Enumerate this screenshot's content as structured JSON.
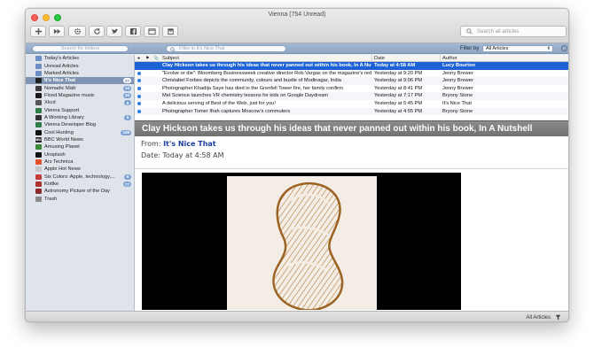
{
  "window": {
    "title": "Vienna (754 Unread)"
  },
  "toolbar": {
    "buttons": [
      {
        "name": "new-subscription",
        "icon": "plus-icon"
      },
      {
        "name": "skip-unread",
        "icon": "fast-forward-icon"
      },
      {
        "name": "action-menu",
        "icon": "gear-icon"
      },
      {
        "name": "refresh",
        "icon": "refresh-icon"
      },
      {
        "name": "share-twitter",
        "icon": "bird-icon"
      },
      {
        "name": "share-facebook",
        "icon": "facebook-icon"
      },
      {
        "name": "open-browser",
        "icon": "window-icon"
      },
      {
        "name": "archive",
        "icon": "archive-icon"
      }
    ],
    "search_placeholder": "Search all articles"
  },
  "filterbar": {
    "folder_search_placeholder": "Search for folders",
    "article_filter_placeholder": "Filter in It's Nice That",
    "filter_by_label": "Filter by",
    "filter_by_value": "All Articles"
  },
  "sidebar": {
    "items": [
      {
        "label": "Today's Articles",
        "badge": "",
        "icon_color": "#6d8fc6",
        "icon_text": ""
      },
      {
        "label": "Unread Articles",
        "badge": "",
        "icon_color": "#6d8fc6",
        "icon_text": ""
      },
      {
        "label": "Marked Articles",
        "badge": "",
        "icon_color": "#6d8fc6",
        "icon_text": ""
      },
      {
        "label": "It's Nice That",
        "badge": "37",
        "icon_color": "#222222",
        "icon_text": "",
        "selected": true
      },
      {
        "label": "Nomadic Matt",
        "badge": "10",
        "icon_color": "#3d3d3d",
        "icon_text": ""
      },
      {
        "label": "Flood Magazine music",
        "badge": "30",
        "icon_color": "#1a1a1a",
        "icon_text": ""
      },
      {
        "label": "Xkcd",
        "badge": "6",
        "icon_color": "#555555",
        "icon_text": ""
      },
      {
        "label": "Vienna Support",
        "badge": "",
        "icon_color": "#2e7d4a",
        "icon_text": ""
      },
      {
        "label": "A Working Library",
        "badge": "5",
        "icon_color": "#303030",
        "icon_text": ""
      },
      {
        "label": "Vienna Developer Blog",
        "badge": "",
        "icon_color": "#2e7d4a",
        "icon_text": ""
      },
      {
        "label": "Cool Hunting",
        "badge": "108",
        "icon_color": "#111111",
        "icon_text": ""
      },
      {
        "label": "BBC World News",
        "badge": "",
        "icon_color": "#222222",
        "icon_text": "BBC"
      },
      {
        "label": "Amusing Planet",
        "badge": "",
        "icon_color": "#3a8a3a",
        "icon_text": ""
      },
      {
        "label": "Unsplash",
        "badge": "",
        "icon_color": "#111111",
        "icon_text": ""
      },
      {
        "label": "Ars Technica",
        "badge": "",
        "icon_color": "#e4512c",
        "icon_text": ""
      },
      {
        "label": "Apple Hot News",
        "badge": "",
        "icon_color": "#c7c7c7",
        "icon_text": ""
      },
      {
        "label": "Six Colors: Apple, technology,...",
        "badge": "6",
        "icon_color": "#c33b3b",
        "icon_text": ""
      },
      {
        "label": "Kottke",
        "badge": "77",
        "icon_color": "#b03030",
        "icon_text": ""
      },
      {
        "label": "Astronomy Picture of the Day",
        "badge": "",
        "icon_color": "#8c2b2b",
        "icon_text": ""
      },
      {
        "label": "Trash",
        "badge": "",
        "icon_color": "#8a8a8a",
        "icon_text": ""
      }
    ]
  },
  "article_list": {
    "columns": {
      "subject": "Subject",
      "date": "Date",
      "author": "Author"
    },
    "rows": [
      {
        "subject": "Clay Hickson takes us through his ideas that never panned out within his book, In A Nutshell",
        "date": "Today at 4:58 AM",
        "author": "Lucy Bourton",
        "unread": false,
        "selected": true
      },
      {
        "subject": "\"Evolve or die\": Bloomberg Businessweek creative director Rob Vargas on the magazine's rede...",
        "date": "Yesterday at 9:20 PM",
        "author": "Jenny Brewer",
        "unread": true,
        "selected": false
      },
      {
        "subject": "Christabel Forbes depicts the community, colours and bustle of Modinagar, India",
        "date": "Yesterday at 9:06 PM",
        "author": "Jenny Brewer",
        "unread": true,
        "selected": false
      },
      {
        "subject": "Photographer Khadija Saye has died in the Grenfell Tower fire, her family confirm",
        "date": "Yesterday at 8:41 PM",
        "author": "Jenny Brewer",
        "unread": true,
        "selected": false
      },
      {
        "subject": "Mel Science launches VR chemistry lessons for kids on Google Daydream",
        "date": "Yesterday at 7:17 PM",
        "author": "Bryony Stone",
        "unread": true,
        "selected": false
      },
      {
        "subject": "A delicious serving of Best of the Web, just for you!",
        "date": "Yesterday at 5:45 PM",
        "author": "It's Nice That",
        "unread": true,
        "selected": false
      },
      {
        "subject": "Photographer Tomer Ifrah captures Moscow's commuters",
        "date": "Yesterday at 4:55 PM",
        "author": "Bryony Stone",
        "unread": true,
        "selected": false
      }
    ]
  },
  "article": {
    "title": "Clay Hickson takes us through his ideas that never panned out within his book, In A Nutshell",
    "from_label": "From:",
    "from_value": "It's Nice That",
    "date_label": "Date:",
    "date_value": "Today at 4:58 AM"
  },
  "statusbar": {
    "filter_label": "All Articles"
  }
}
